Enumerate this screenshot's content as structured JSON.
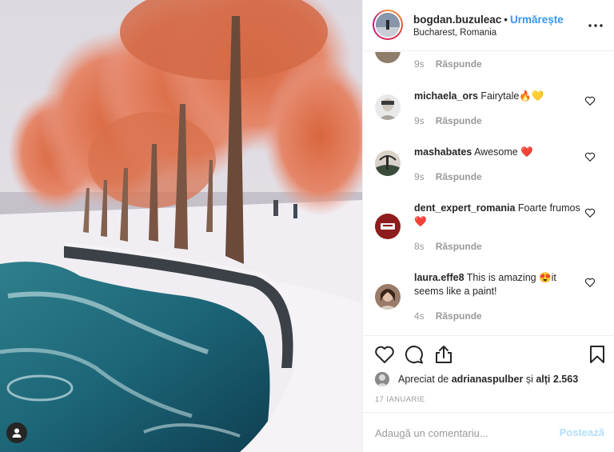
{
  "header": {
    "username": "bogdan.buzuleac",
    "separator": "•",
    "follow_label": "Urmărește",
    "location": "Bucharest, Romania",
    "more_icon": "more-options-icon"
  },
  "comments": [
    {
      "user": "",
      "text": "",
      "time": "9s",
      "reply": "Răspunde"
    },
    {
      "user": "michaela_ors",
      "text": "Fairytale🔥💛",
      "time": "9s",
      "reply": "Răspunde"
    },
    {
      "user": "mashabates",
      "text": "Awesome ❤️",
      "time": "9s",
      "reply": "Răspunde"
    },
    {
      "user": "dent_expert_romania",
      "text": "Foarte frumos❤️",
      "time": "8s",
      "reply": "Răspunde"
    },
    {
      "user": "laura.effe8",
      "text": "This is amazing 😍it seems like a paint!",
      "time": "4s",
      "reply": "Răspunde"
    }
  ],
  "likes": {
    "prefix": "Apreciat de",
    "user": "adrianaspulber",
    "middle": "și",
    "others": "alți 2.563"
  },
  "date": "17 IANUARIE",
  "add_comment": {
    "placeholder": "Adaugă un comentariu...",
    "post_label": "Postează"
  },
  "colors": {
    "accent": "#3897f0",
    "post_disabled": "#b2dffc",
    "muted": "#999999"
  }
}
